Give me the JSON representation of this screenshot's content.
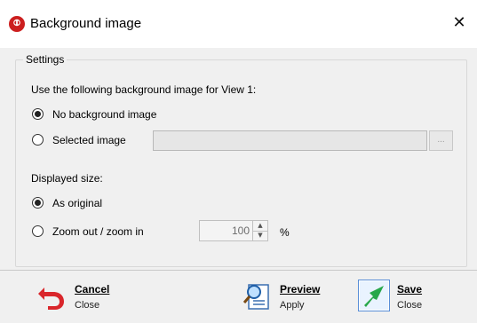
{
  "window": {
    "title": "Background image",
    "close_glyph": "✕"
  },
  "settings": {
    "group_label": "Settings",
    "instruction": "Use the following background image for View 1:",
    "options": {
      "no_background": "No background image",
      "selected_image": "Selected image"
    },
    "selected_option": "no_background",
    "image_path_value": "",
    "browse_label": "...",
    "size_label": "Displayed size:",
    "size_options": {
      "as_original": "As original",
      "zoom": "Zoom out / zoom in"
    },
    "selected_size_option": "as_original",
    "zoom_value": "100",
    "zoom_unit": "%"
  },
  "footer": {
    "cancel": {
      "label": "Cancel",
      "sub": "Close",
      "icon": "undo-arrow-icon",
      "color": "#d9262b"
    },
    "preview": {
      "label": "Preview",
      "sub": "Apply",
      "icon": "magnifier-document-icon",
      "color": "#2b78c6"
    },
    "save": {
      "label": "Save",
      "sub": "Close",
      "icon": "check-arrow-icon",
      "color": "#27a84a"
    }
  },
  "colors": {
    "titlebar_bg": "#ffffff",
    "dialog_bg": "#f0f0f0",
    "app_icon": "#cc1f1f"
  }
}
